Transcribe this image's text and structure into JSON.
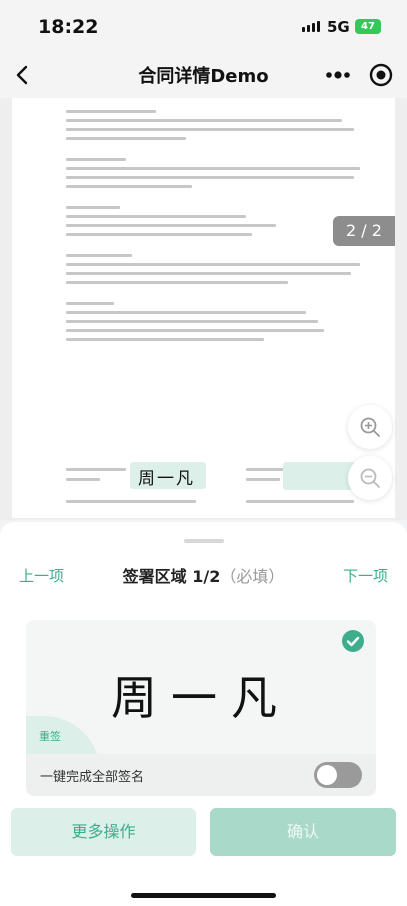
{
  "status_bar": {
    "time": "18:22",
    "network": "5G",
    "battery": "47"
  },
  "nav": {
    "title": "合同详情Demo",
    "back_icon": "chevron-left-icon",
    "more_icon": "more-dots-icon",
    "target_icon": "target-icon"
  },
  "document": {
    "page_indicator": "2 / 2",
    "signature_preview": "周一凡"
  },
  "sign_panel": {
    "prev_label": "上一项",
    "next_label": "下一项",
    "area_title": "签署区域 1/2",
    "area_required": "（必填）",
    "signature_text": "周一凡",
    "tag_label": "重签",
    "toggle_label": "一键完成全部签名",
    "toggle_on": false
  },
  "actions": {
    "more_label": "更多操作",
    "confirm_label": "确认"
  },
  "colors": {
    "accent": "#3dae8c",
    "accent_light": "#dcefe8",
    "confirm_disabled": "#a9d9c9"
  }
}
